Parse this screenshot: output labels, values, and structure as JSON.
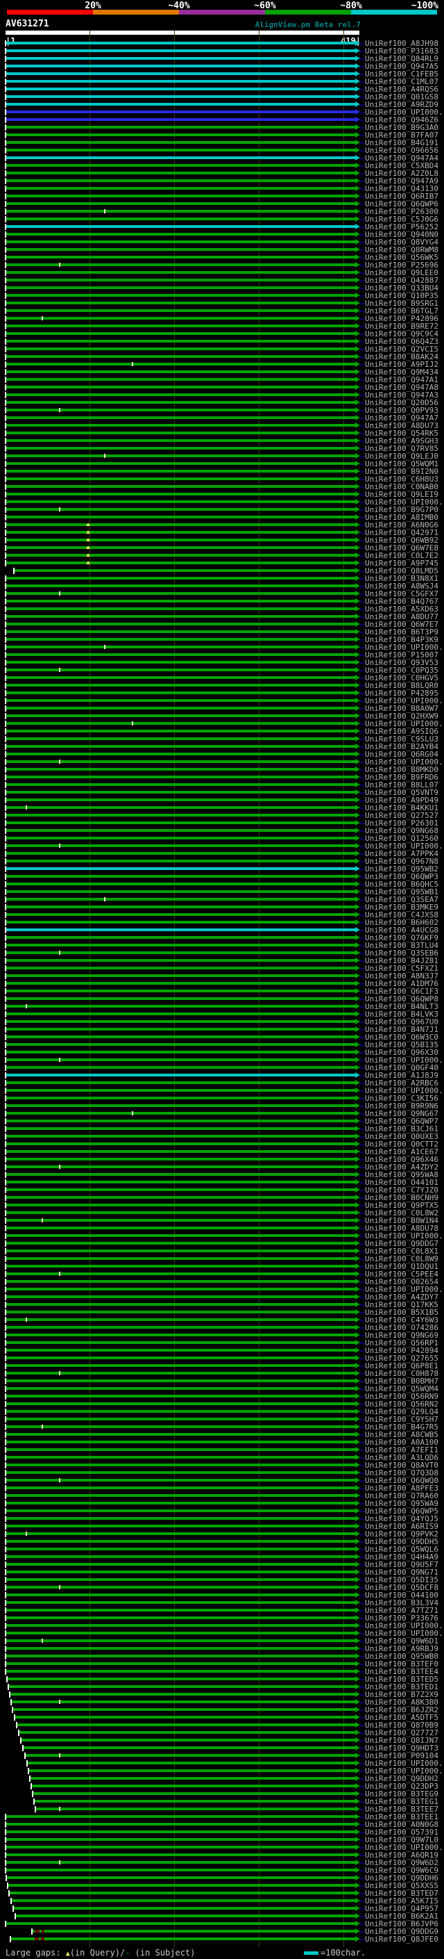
{
  "header": {
    "key_labels": [
      "20%",
      "~40%",
      "~60%",
      "~80%",
      "~100%"
    ],
    "key_colors": [
      "#ff0000",
      "#e07800",
      "#9b2d9b",
      "#00a000",
      "#00c8c8"
    ],
    "query_id": "AV631271",
    "app_title": "AlignView.pm Beta rel.7",
    "ruler_start": "|1",
    "ruler_end": "419|"
  },
  "colors": {
    "green": "#00a400",
    "cyan": "#00c8c8",
    "blue": "#2a2ae0"
  },
  "legend": {
    "prefix": "Large gaps: ",
    "query_gap_symbol": "▲",
    "mid": "(in Query)/",
    "subject_gap_symbol": "-",
    "suffix": " (in Subject)",
    "scale_label": "=100char."
  },
  "rows": [
    {
      "l": "UniRef100_A8JH98",
      "c": "cyan"
    },
    {
      "l": "UniRef100_P31683",
      "c": "cyan"
    },
    {
      "l": "UniRef100_Q84RL9",
      "c": "cyan"
    },
    {
      "l": "UniRef100_Q947A5",
      "c": "cyan"
    },
    {
      "l": "UniRef100_C1FEB5",
      "c": "cyan"
    },
    {
      "l": "UniRef100_C1ML07",
      "c": "cyan"
    },
    {
      "l": "UniRef100_A4RQS6",
      "c": "cyan"
    },
    {
      "l": "UniRef100_Q01GS8",
      "c": "cyan"
    },
    {
      "l": "UniRef100_A9RZD9",
      "c": "cyan"
    },
    {
      "l": "UniRef100_UPI000..",
      "c": "blue"
    },
    {
      "l": "UniRef100_Q946Z6",
      "c": "blue"
    },
    {
      "l": "UniRef100_B9G3A0"
    },
    {
      "l": "UniRef100_B7FA07"
    },
    {
      "l": "UniRef100_B4G191"
    },
    {
      "l": "UniRef100_O96656"
    },
    {
      "l": "UniRef100_Q947A4",
      "c": "cyan"
    },
    {
      "l": "UniRef100_C5XBD4"
    },
    {
      "l": "UniRef100_A2Z0L8"
    },
    {
      "l": "UniRef100_Q947A9"
    },
    {
      "l": "UniRef100_Q43130"
    },
    {
      "l": "UniRef100_Q6RIB7"
    },
    {
      "l": "UniRef100_Q6QWP6"
    },
    {
      "l": "UniRef100_P26300",
      "k": [
        150
      ]
    },
    {
      "l": "UniRef100_C5J0G6"
    },
    {
      "l": "UniRef100_P56252",
      "c": "cyan"
    },
    {
      "l": "UniRef100_Q940N0"
    },
    {
      "l": "UniRef100_Q8VYG4"
    },
    {
      "l": "UniRef100_Q8RWM8"
    },
    {
      "l": "UniRef100_Q56WK5"
    },
    {
      "l": "UniRef100_P25696",
      "k": [
        85
      ]
    },
    {
      "l": "UniRef100_Q9LEE0"
    },
    {
      "l": "UniRef100_Q42887"
    },
    {
      "l": "UniRef100_Q33BU4"
    },
    {
      "l": "UniRef100_Q10P35"
    },
    {
      "l": "UniRef100_B9SRG1"
    },
    {
      "l": "UniRef100_B6TGL7"
    },
    {
      "l": "UniRef100_P42896",
      "k": [
        60
      ]
    },
    {
      "l": "UniRef100_B9RE72"
    },
    {
      "l": "UniRef100_Q9C9C4"
    },
    {
      "l": "UniRef100_Q6Q4Z3"
    },
    {
      "l": "UniRef100_Q2VCI5"
    },
    {
      "l": "UniRef100_B8AK24"
    },
    {
      "l": "UniRef100_A9PIJ2",
      "k": [
        190
      ]
    },
    {
      "l": "UniRef100_Q9M434"
    },
    {
      "l": "UniRef100_Q947A1"
    },
    {
      "l": "UniRef100_Q947A8"
    },
    {
      "l": "UniRef100_Q947A3"
    },
    {
      "l": "UniRef100_Q20D56"
    },
    {
      "l": "UniRef100_Q0PV93",
      "k": [
        85
      ]
    },
    {
      "l": "UniRef100_Q947A7"
    },
    {
      "l": "UniRef100_A8DU73"
    },
    {
      "l": "UniRef100_Q54RK5"
    },
    {
      "l": "UniRef100_A9SGH3"
    },
    {
      "l": "UniRef100_Q7RV85"
    },
    {
      "l": "UniRef100_Q9LEJ0",
      "k": [
        150
      ]
    },
    {
      "l": "UniRef100_Q5WQM1"
    },
    {
      "l": "UniRef100_B9I2N0"
    },
    {
      "l": "UniRef100_C6H8U3"
    },
    {
      "l": "UniRef100_C0NAB0"
    },
    {
      "l": "UniRef100_Q9LEI9"
    },
    {
      "l": "UniRef100_UPI000.."
    },
    {
      "l": "UniRef100_B9G7P0",
      "k": [
        85
      ]
    },
    {
      "l": "UniRef100_A8IMB0"
    },
    {
      "l": "UniRef100_A6N0G6",
      "t": [
        127
      ]
    },
    {
      "l": "UniRef100_Q42971",
      "t": [
        127
      ]
    },
    {
      "l": "UniRef100_Q6WB92",
      "t": [
        127
      ]
    },
    {
      "l": "UniRef100_Q6W7E8",
      "t": [
        127
      ]
    },
    {
      "l": "UniRef100_C0L7E2",
      "t": [
        127
      ]
    },
    {
      "l": "UniRef100_A9P745",
      "t": [
        127
      ]
    },
    {
      "l": "UniRef100_Q8LMD5",
      "s": 21
    },
    {
      "l": "UniRef100_B3N8X1"
    },
    {
      "l": "UniRef100_A8WSJ4"
    },
    {
      "l": "UniRef100_C5GFX7",
      "k": [
        85
      ]
    },
    {
      "l": "UniRef100_B4Q767"
    },
    {
      "l": "UniRef100_A5XD63"
    },
    {
      "l": "UniRef100_A8DU77"
    },
    {
      "l": "UniRef100_Q6W7E7"
    },
    {
      "l": "UniRef100_B6T3P9"
    },
    {
      "l": "UniRef100_B4P3K9"
    },
    {
      "l": "UniRef100_UPI000..",
      "k": [
        150
      ]
    },
    {
      "l": "UniRef100_P15007"
    },
    {
      "l": "UniRef100_Q93V53"
    },
    {
      "l": "UniRef100_C0PQ35",
      "k": [
        85
      ]
    },
    {
      "l": "UniRef100_C0HGV5"
    },
    {
      "l": "UniRef100_B8LQR0"
    },
    {
      "l": "UniRef100_P42895"
    },
    {
      "l": "UniRef100_UPI000.."
    },
    {
      "l": "UniRef100_B8A0W7"
    },
    {
      "l": "UniRef100_Q2HXW9"
    },
    {
      "l": "UniRef100_UPI000..",
      "k": [
        190
      ]
    },
    {
      "l": "UniRef100_A9SIQ6"
    },
    {
      "l": "UniRef100_C9SLU3"
    },
    {
      "l": "UniRef100_B2AYB4"
    },
    {
      "l": "UniRef100_Q6RG04"
    },
    {
      "l": "UniRef100_UPI000..",
      "k": [
        85
      ]
    },
    {
      "l": "UniRef100_B8MKD0"
    },
    {
      "l": "UniRef100_B9FRD6"
    },
    {
      "l": "UniRef100_B8LL07"
    },
    {
      "l": "UniRef100_Q5VNT9"
    },
    {
      "l": "UniRef100_A9PD49"
    },
    {
      "l": "UniRef100_B4KKU1",
      "k": [
        37
      ]
    },
    {
      "l": "UniRef100_Q27527"
    },
    {
      "l": "UniRef100_P26301"
    },
    {
      "l": "UniRef100_Q9NG68"
    },
    {
      "l": "UniRef100_Q12560"
    },
    {
      "l": "UniRef100_UPI000..",
      "k": [
        85
      ]
    },
    {
      "l": "UniRef100_A7PPK4"
    },
    {
      "l": "UniRef100_Q967N8"
    },
    {
      "l": "UniRef100_Q95WB2",
      "c": "cyan"
    },
    {
      "l": "UniRef100_Q6QWP3"
    },
    {
      "l": "UniRef100_B6QHC5"
    },
    {
      "l": "UniRef100_Q95WB1"
    },
    {
      "l": "UniRef100_Q3SEA7",
      "k": [
        150
      ]
    },
    {
      "l": "UniRef100_B3MKE9"
    },
    {
      "l": "UniRef100_C4JXS8"
    },
    {
      "l": "UniRef100_B6H602"
    },
    {
      "l": "UniRef100_A4UCG8",
      "c": "cyan"
    },
    {
      "l": "UniRef100_Q76KF9"
    },
    {
      "l": "UniRef100_B3TLU4"
    },
    {
      "l": "UniRef100_Q3SEB6",
      "k": [
        85
      ]
    },
    {
      "l": "UniRef100_B4JZ81"
    },
    {
      "l": "UniRef100_C5FXZ1"
    },
    {
      "l": "UniRef100_A8N3J7"
    },
    {
      "l": "UniRef100_A1DM76"
    },
    {
      "l": "UniRef100_Q6C1F3"
    },
    {
      "l": "UniRef100_Q6QWP8"
    },
    {
      "l": "UniRef100_B4NLT3",
      "k": [
        37
      ]
    },
    {
      "l": "UniRef100_B4LVK3"
    },
    {
      "l": "UniRef100_Q967U0"
    },
    {
      "l": "UniRef100_B4N7J1"
    },
    {
      "l": "UniRef100_Q6W3C0"
    },
    {
      "l": "UniRef100_Q5B135"
    },
    {
      "l": "UniRef100_Q96X30"
    },
    {
      "l": "UniRef100_UPI000..",
      "k": [
        85
      ]
    },
    {
      "l": "UniRef100_Q0GF40"
    },
    {
      "l": "UniRef100_A1J8J9",
      "c": "cyan"
    },
    {
      "l": "UniRef100_A2RBC6"
    },
    {
      "l": "UniRef100_UPI000.."
    },
    {
      "l": "UniRef100_C3KI56"
    },
    {
      "l": "UniRef100_B9R9N6"
    },
    {
      "l": "UniRef100_Q9NG67",
      "k": [
        190
      ]
    },
    {
      "l": "UniRef100_Q6QWP7"
    },
    {
      "l": "UniRef100_B3CJ61"
    },
    {
      "l": "UniRef100_Q0UXE3"
    },
    {
      "l": "UniRef100_Q0CTT2"
    },
    {
      "l": "UniRef100_A1CE67"
    },
    {
      "l": "UniRef100_Q96X46"
    },
    {
      "l": "UniRef100_A4ZDY2",
      "k": [
        85
      ]
    },
    {
      "l": "UniRef100_Q95WA8"
    },
    {
      "l": "UniRef100_O44101"
    },
    {
      "l": "UniRef100_C7YJZ0"
    },
    {
      "l": "UniRef100_B0CNH9"
    },
    {
      "l": "UniRef100_Q9PTX5"
    },
    {
      "l": "UniRef100_C0L8W2"
    },
    {
      "l": "UniRef100_B0W1N4",
      "k": [
        60
      ]
    },
    {
      "l": "UniRef100_A8DU78"
    },
    {
      "l": "UniRef100_UPI000.."
    },
    {
      "l": "UniRef100_Q9DDG7"
    },
    {
      "l": "UniRef100_C0L8X1"
    },
    {
      "l": "UniRef100_C0L8W9"
    },
    {
      "l": "UniRef100_Q1DQU1"
    },
    {
      "l": "UniRef100_C5PEE4",
      "k": [
        85
      ]
    },
    {
      "l": "UniRef100_O02654"
    },
    {
      "l": "UniRef100_UPI000.."
    },
    {
      "l": "UniRef100_A4ZDY7"
    },
    {
      "l": "UniRef100_Q17KK5"
    },
    {
      "l": "UniRef100_B5X1B5"
    },
    {
      "l": "UniRef100_C4Y6W3",
      "k": [
        37
      ]
    },
    {
      "l": "UniRef100_O74286"
    },
    {
      "l": "UniRef100_Q9NG69"
    },
    {
      "l": "UniRef100_Q56RP1"
    },
    {
      "l": "UniRef100_P42894"
    },
    {
      "l": "UniRef100_Q27655"
    },
    {
      "l": "UniRef100_Q6P8E1"
    },
    {
      "l": "UniRef100_C0H878",
      "k": [
        85
      ]
    },
    {
      "l": "UniRef100_B0BMH7"
    },
    {
      "l": "UniRef100_Q5WQM4"
    },
    {
      "l": "UniRef100_Q56RN9"
    },
    {
      "l": "UniRef100_Q56RN2"
    },
    {
      "l": "UniRef100_Q29LQ4"
    },
    {
      "l": "UniRef100_C9YSH7"
    },
    {
      "l": "UniRef100_B4G7R5",
      "k": [
        60
      ]
    },
    {
      "l": "UniRef100_A8CWB5"
    },
    {
      "l": "UniRef100_A0A100"
    },
    {
      "l": "UniRef100_A7EFI1"
    },
    {
      "l": "UniRef100_A3LQD6"
    },
    {
      "l": "UniRef100_Q8AVT0"
    },
    {
      "l": "UniRef100_Q7Q3D8"
    },
    {
      "l": "UniRef100_Q6QWQ0",
      "k": [
        85
      ]
    },
    {
      "l": "UniRef100_A8PFE3"
    },
    {
      "l": "UniRef100_Q7RA60"
    },
    {
      "l": "UniRef100_Q95WA9"
    },
    {
      "l": "UniRef100_Q6QWP5"
    },
    {
      "l": "UniRef100_Q4YQJ5"
    },
    {
      "l": "UniRef100_A6RIS9"
    },
    {
      "l": "UniRef100_Q9PVK2",
      "k": [
        37
      ]
    },
    {
      "l": "UniRef100_Q9DDH5"
    },
    {
      "l": "UniRef100_Q5WQL6"
    },
    {
      "l": "UniRef100_Q4H4A9"
    },
    {
      "l": "UniRef100_Q9U5F7"
    },
    {
      "l": "UniRef100_Q9NG71"
    },
    {
      "l": "UniRef100_Q5DI35"
    },
    {
      "l": "UniRef100_Q5DCF8",
      "k": [
        85
      ]
    },
    {
      "l": "UniRef100_O44100"
    },
    {
      "l": "UniRef100_B3L3V4"
    },
    {
      "l": "UniRef100_A7TZ71"
    },
    {
      "l": "UniRef100_P33676"
    },
    {
      "l": "UniRef100_UPI000.."
    },
    {
      "l": "UniRef100_UPI000.."
    },
    {
      "l": "UniRef100_Q9W6D1",
      "k": [
        60
      ]
    },
    {
      "l": "UniRef100_A9RBJ9"
    },
    {
      "l": "UniRef100_Q95WB0"
    },
    {
      "l": "UniRef100_B3TEF0"
    },
    {
      "l": "UniRef100_B3TEE4"
    },
    {
      "l": "UniRef100_B3TED5",
      "s": 11
    },
    {
      "l": "UniRef100_B3TED1",
      "s": 13
    },
    {
      "l": "UniRef100_B7Z2X9",
      "s": 15
    },
    {
      "l": "UniRef100_A8K3B0",
      "s": 17,
      "k": [
        85
      ]
    },
    {
      "l": "UniRef100_B6JZR2",
      "s": 19
    },
    {
      "l": "UniRef100_A5DTF5",
      "s": 22
    },
    {
      "l": "UniRef100_Q870B9",
      "s": 25
    },
    {
      "l": "UniRef100_Q27727",
      "s": 28
    },
    {
      "l": "UniRef100_Q8IJN7",
      "s": 31
    },
    {
      "l": "UniRef100_Q9HDT3",
      "s": 34
    },
    {
      "l": "UniRef100_P09104",
      "s": 37,
      "k": [
        85
      ]
    },
    {
      "l": "UniRef100_UPI000..",
      "s": 40
    },
    {
      "l": "UniRef100_UPI000..",
      "s": 42
    },
    {
      "l": "UniRef100_Q9DDH2",
      "s": 44
    },
    {
      "l": "UniRef100_Q23DP3",
      "s": 46
    },
    {
      "l": "UniRef100_B3TEG9",
      "s": 48
    },
    {
      "l": "UniRef100_B3TEG1",
      "s": 50
    },
    {
      "l": "UniRef100_B3TEE7",
      "s": 52,
      "k": [
        85
      ]
    },
    {
      "l": "UniRef100_B3TEE1"
    },
    {
      "l": "UniRef100_A0N0G8"
    },
    {
      "l": "UniRef100_O57391"
    },
    {
      "l": "UniRef100_Q9W7L0"
    },
    {
      "l": "UniRef100_UPI000.."
    },
    {
      "l": "UniRef100_A6QR19"
    },
    {
      "l": "UniRef100_Q9W6D2",
      "k": [
        85
      ]
    },
    {
      "l": "UniRef100_Q9W6C9"
    },
    {
      "l": "UniRef100_Q9DDH6",
      "s": 10
    },
    {
      "l": "UniRef100_Q5XXS5",
      "s": 12
    },
    {
      "l": "UniRef100_B3TED7",
      "s": 14
    },
    {
      "l": "UniRef100_A5K7I5",
      "s": 17
    },
    {
      "l": "UniRef100_Q4P957",
      "s": 20
    },
    {
      "l": "UniRef100_B6K2A1",
      "s": 23
    },
    {
      "l": "UniRef100_B6JVP6"
    },
    {
      "l": "UniRef100_Q9DDG9",
      "s": 47,
      "d": [
        [
          50,
          7
        ],
        [
          60,
          4
        ]
      ]
    },
    {
      "l": "UniRef100_Q8JFE0",
      "s": 16,
      "d": [
        [
          50,
          6
        ],
        [
          59,
          5
        ]
      ]
    }
  ]
}
